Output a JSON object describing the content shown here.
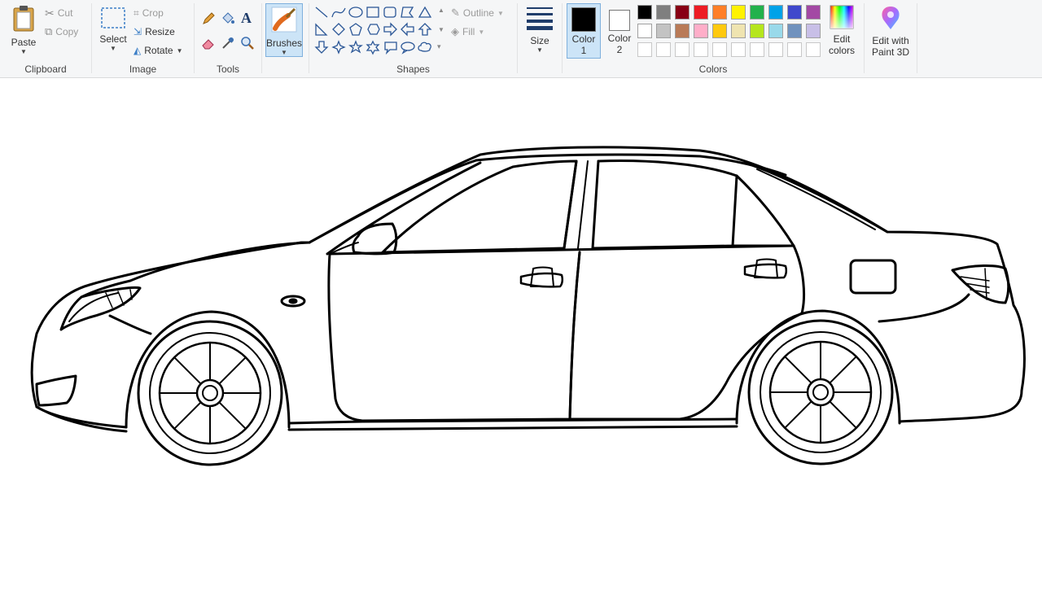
{
  "ribbon": {
    "clipboard": {
      "label": "Clipboard",
      "paste": "Paste",
      "cut": "Cut",
      "copy": "Copy"
    },
    "image": {
      "label": "Image",
      "select": "Select",
      "crop": "Crop",
      "resize": "Resize",
      "rotate": "Rotate"
    },
    "tools": {
      "label": "Tools"
    },
    "brushes": {
      "label": "Brushes"
    },
    "shapes": {
      "label": "Shapes",
      "outline": "Outline",
      "fill": "Fill"
    },
    "size": {
      "label": "Size"
    },
    "colors": {
      "label": "Colors",
      "color1_line1": "Color",
      "color1_line2": "1",
      "color2_line1": "Color",
      "color2_line2": "2",
      "color1_value": "#000000",
      "color2_value": "#ffffff",
      "edit_colors_line1": "Edit",
      "edit_colors_line2": "colors",
      "palette_row1": [
        "#000000",
        "#7f7f7f",
        "#880015",
        "#ed1c24",
        "#ff7f27",
        "#fff200",
        "#22b14c",
        "#00a2e8",
        "#3f48cc",
        "#a349a4"
      ],
      "palette_row2": [
        "#ffffff",
        "#c3c3c3",
        "#b97a57",
        "#ffaec9",
        "#ffc90e",
        "#efe4b0",
        "#b5e61d",
        "#99d9ea",
        "#7092be",
        "#c8bfe7"
      ],
      "palette_row3": [
        "#ffffff",
        "#ffffff",
        "#ffffff",
        "#ffffff",
        "#ffffff",
        "#ffffff",
        "#ffffff",
        "#ffffff",
        "#ffffff",
        "#ffffff"
      ]
    },
    "paint3d": {
      "line1": "Edit with",
      "line2": "Paint 3D"
    }
  }
}
